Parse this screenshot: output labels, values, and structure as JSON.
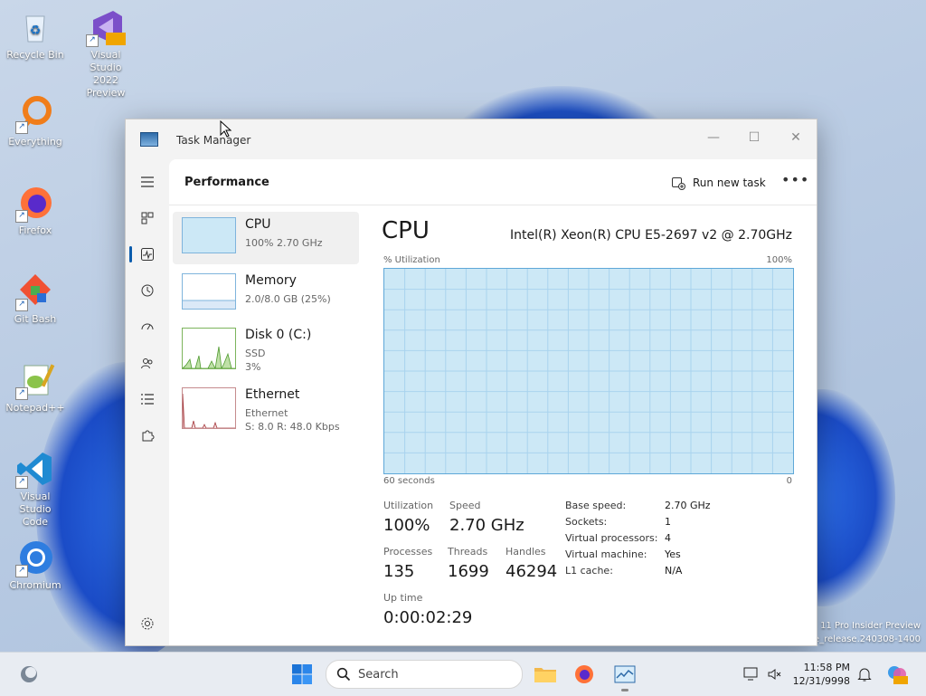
{
  "desktop": {
    "icons": [
      {
        "label": "Recycle Bin",
        "icon": "recycle-bin-icon"
      },
      {
        "label": "Visual Studio 2022 Preview",
        "line1": "Visual Studio",
        "line2": "2022 Preview",
        "badge": "PRE",
        "icon": "visual-studio-preview-icon"
      },
      {
        "label": "Everything",
        "icon": "everything-search-icon"
      },
      {
        "label": "Firefox",
        "icon": "firefox-icon"
      },
      {
        "label": "Git Bash",
        "icon": "git-bash-icon"
      },
      {
        "label": "Notepad++",
        "icon": "notepadplusplus-icon"
      },
      {
        "label": "Visual Studio Code",
        "line1": "Visual Studio",
        "line2": "Code",
        "icon": "vscode-icon"
      },
      {
        "label": "Chromium",
        "icon": "chromium-icon"
      }
    ],
    "watermark": {
      "line1": "11 Pro Insider Preview",
      "line2": "e_release.240308-1400"
    }
  },
  "window": {
    "title": "Task Manager",
    "controls": {
      "minimize": "—",
      "maximize": "☐",
      "close": "✕"
    }
  },
  "header": {
    "page_title": "Performance",
    "run_new_task": "Run new task",
    "more": "•••"
  },
  "sidebar": {
    "items": [
      {
        "name": "CPU",
        "sub1": "100% 2.70 GHz"
      },
      {
        "name": "Memory",
        "sub1": "2.0/8.0 GB (25%)"
      },
      {
        "name": "Disk 0 (C:)",
        "sub1": "SSD",
        "sub2": "3%"
      },
      {
        "name": "Ethernet",
        "sub1": "Ethernet",
        "sub2": "S: 8.0 R: 48.0 Kbps"
      }
    ]
  },
  "detail": {
    "title": "CPU",
    "model": "Intel(R) Xeon(R) CPU E5-2697 v2 @ 2.70GHz",
    "graph_label_left": "% Utilization",
    "graph_label_right": "100%",
    "axis_left": "60 seconds",
    "axis_right": "0",
    "utilization_label": "Utilization",
    "utilization_value": "100%",
    "speed_label": "Speed",
    "speed_value": "2.70 GHz",
    "processes_label": "Processes",
    "processes_value": "135",
    "threads_label": "Threads",
    "threads_value": "1699",
    "handles_label": "Handles",
    "handles_value": "46294",
    "uptime_label": "Up time",
    "uptime_value": "0:00:02:29",
    "specs": [
      {
        "k": "Base speed:",
        "v": "2.70 GHz"
      },
      {
        "k": "Sockets:",
        "v": "1"
      },
      {
        "k": "Virtual processors:",
        "v": "4"
      },
      {
        "k": "Virtual machine:",
        "v": "Yes"
      },
      {
        "k": "L1 cache:",
        "v": "N/A"
      }
    ]
  },
  "taskbar": {
    "search_placeholder": "Search",
    "time": "11:58 PM",
    "date": "12/31/9998"
  },
  "colors": {
    "accent": "#0b5cad",
    "graph_fill": "#cce8f6",
    "graph_line": "#5fa8d8",
    "disk_graph": "#4e9a2e",
    "ethernet_graph": "#a5373b"
  }
}
